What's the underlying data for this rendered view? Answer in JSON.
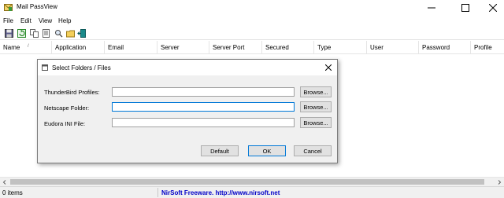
{
  "window": {
    "title": "Mail PassView"
  },
  "menu": {
    "items": [
      "File",
      "Edit",
      "View",
      "Help"
    ]
  },
  "toolbar": {
    "buttons": [
      "save-icon",
      "refresh-icon",
      "copy-icon",
      "properties-icon",
      "open-folder-icon",
      "exit-icon"
    ]
  },
  "list": {
    "columns": [
      "Name",
      "Application",
      "Email",
      "Server",
      "Server Port",
      "Secured",
      "Type",
      "User",
      "Password",
      "Profile"
    ],
    "sort_indicator": "/"
  },
  "dialog": {
    "title": "Select Folders / Files",
    "fields": [
      {
        "label": "ThunderBird Profiles:",
        "value": "",
        "browse": "Browse..."
      },
      {
        "label": "Netscape Folder:",
        "value": "",
        "browse": "Browse..."
      },
      {
        "label": "Eudora INI File:",
        "value": "",
        "browse": "Browse..."
      }
    ],
    "buttons": {
      "default": "Default",
      "ok": "OK",
      "cancel": "Cancel"
    }
  },
  "status": {
    "items_count": "0 items",
    "link_text": "NirSoft Freeware.  http://www.nirsoft.net"
  },
  "colors": {
    "link": "#0000c8",
    "focus_border": "#0078d7",
    "dialog_bg": "#f0f0f0"
  }
}
